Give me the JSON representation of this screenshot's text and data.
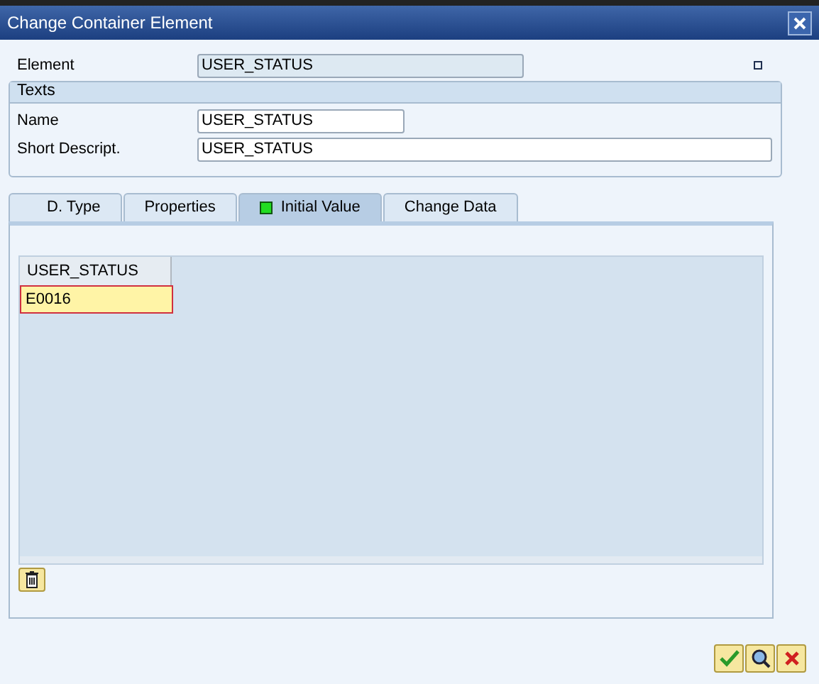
{
  "window": {
    "title": "Change Container Element"
  },
  "element": {
    "label": "Element",
    "value": "USER_STATUS"
  },
  "texts_group": {
    "title": "Texts",
    "fields": [
      {
        "label": "Name",
        "value": "USER_STATUS",
        "kind": "short"
      },
      {
        "label": "Short Descript.",
        "value": "USER_STATUS",
        "kind": "long"
      }
    ]
  },
  "tabs": [
    {
      "label": "D. Type",
      "selected": false,
      "status_icon": false
    },
    {
      "label": "Properties",
      "selected": false,
      "status_icon": false
    },
    {
      "label": "Initial Value",
      "selected": true,
      "status_icon": true
    },
    {
      "label": "Change Data",
      "selected": false,
      "status_icon": false
    }
  ],
  "table": {
    "columns": [
      "USER_STATUS"
    ],
    "rows": [
      [
        "E0016"
      ]
    ]
  }
}
